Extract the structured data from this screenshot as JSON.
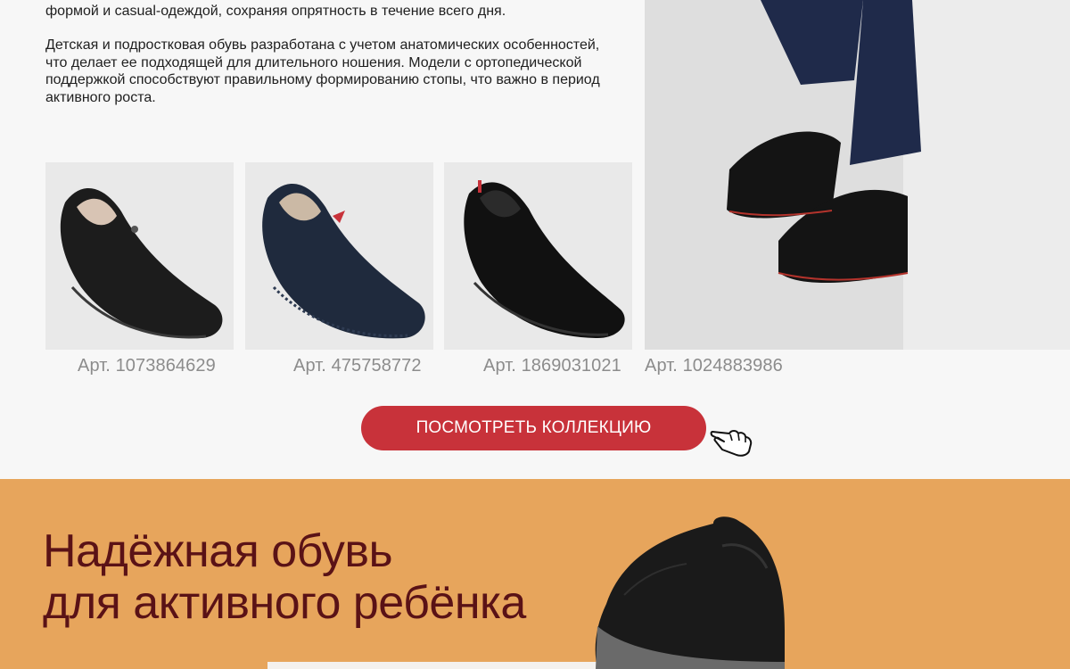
{
  "description": {
    "paragraph1": "формой и casual-одеждой, сохраняя опрятность в течение всего дня.",
    "paragraph2": "Детская и подростковая обувь разработана с учетом анатомических особенностей, что делает ее подходящей для длительного ношения. Модели с ортопедической поддержкой способствуют правильному формированию стопы, что важно в период активного роста."
  },
  "products": [
    {
      "article": "Арт. 1073864629",
      "color": "#1c1c1c"
    },
    {
      "article": "Арт. 475758772",
      "color": "#1f2a3d"
    },
    {
      "article": "Арт. 1869031021",
      "color": "#111111"
    }
  ],
  "hero": {
    "article": "Арт. 1024883986"
  },
  "cta": {
    "label": "ПОСМОТРЕТЬ КОЛЛЕКЦИЮ",
    "icon": "pointing-hand-icon"
  },
  "banner": {
    "title_line1": "Надёжная обувь",
    "title_line2": "для активного ребёнка"
  },
  "colors": {
    "accent": "#c8323a",
    "banner_bg": "#e7a55c",
    "banner_text": "#5a1216",
    "article_text": "#8c8c8c"
  }
}
